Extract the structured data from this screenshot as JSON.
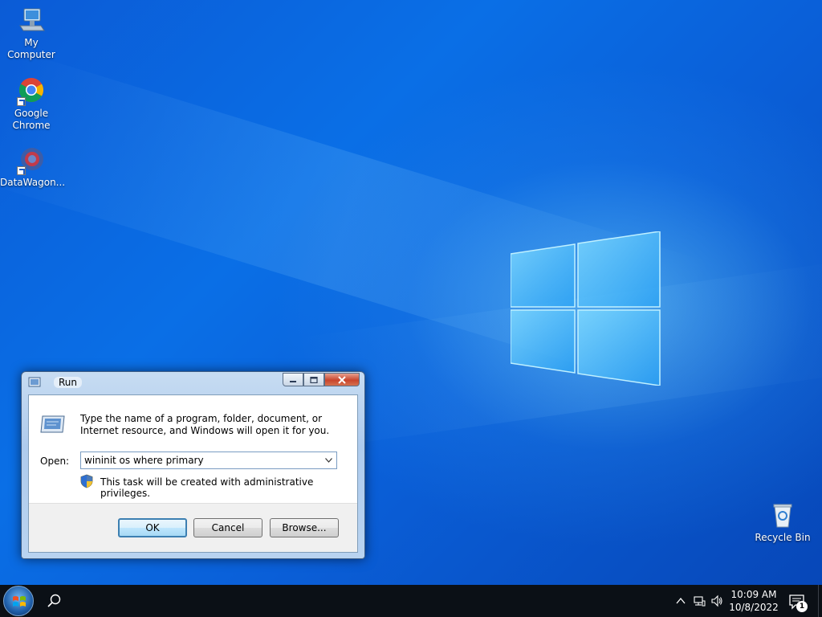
{
  "desktop": {
    "icons": [
      {
        "label": "My Computer",
        "icon": "computer-icon"
      },
      {
        "label": "Google Chrome",
        "icon": "chrome-icon"
      },
      {
        "label": "DataWagon...",
        "icon": "datawagon-icon"
      },
      {
        "label": "Recycle Bin",
        "icon": "recycle-bin-icon"
      }
    ]
  },
  "run_dialog": {
    "title": "Run",
    "description": "Type the name of a program, folder, document, or Internet resource, and Windows will open it for you.",
    "open_label": "Open:",
    "open_value": "wininit os where primary",
    "admin_note": "This task will be created with administrative privileges.",
    "buttons": {
      "ok": "OK",
      "cancel": "Cancel",
      "browse": "Browse..."
    },
    "titlebar_buttons": {
      "minimize": "minimize-icon",
      "maximize": "maximize-icon",
      "close": "close-icon"
    }
  },
  "taskbar": {
    "clock_time": "10:09 AM",
    "clock_date": "10/8/2022",
    "notification_count": "1",
    "tray_icons": [
      "chevron-up-icon",
      "network-icon",
      "volume-icon"
    ]
  },
  "colors": {
    "desktop_blue": "#0a6fe6",
    "taskbar": "#0b1016",
    "ok_button_border": "#3c7fb1"
  }
}
